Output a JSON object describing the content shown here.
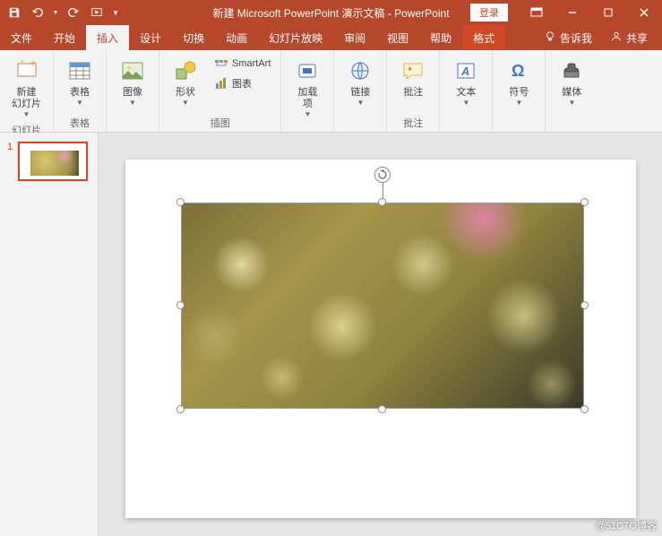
{
  "titlebar": {
    "title": "新建 Microsoft PowerPoint 演示文稿  -  PowerPoint",
    "login": "登录"
  },
  "menu": {
    "file": "文件",
    "home": "开始",
    "insert": "插入",
    "design": "设计",
    "transitions": "切换",
    "animations": "动画",
    "slideshow": "幻灯片放映",
    "review": "审阅",
    "view": "视图",
    "help": "帮助",
    "format": "格式",
    "tellme": "告诉我",
    "share": "共享"
  },
  "ribbon": {
    "slides": {
      "new_slide": "新建\n幻灯片",
      "group": "幻灯片"
    },
    "tables": {
      "table": "表格",
      "group": "表格"
    },
    "images": {
      "image": "图像"
    },
    "illustrations": {
      "shapes": "形状",
      "smartart": "SmartArt",
      "chart": "图表",
      "group": "插图"
    },
    "addins": {
      "addins": "加载\n项"
    },
    "links": {
      "links": "链接"
    },
    "comments": {
      "comments": "批注",
      "group": "批注"
    },
    "text": {
      "text": "文本"
    },
    "symbols": {
      "symbols": "符号"
    },
    "media": {
      "media": "媒体"
    }
  },
  "thumbnails": {
    "items": [
      {
        "num": "1"
      }
    ]
  },
  "watermark": "@51CTO博客"
}
